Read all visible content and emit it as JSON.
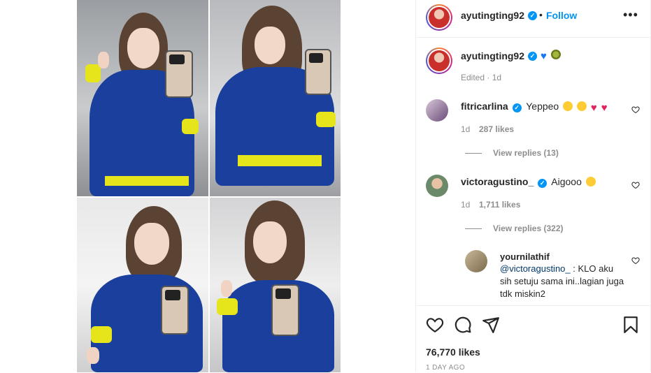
{
  "post": {
    "author": "ayutingting92",
    "follow_label": "Follow",
    "separator": "•",
    "more_label": "•••",
    "caption_meta": "Edited · 1d",
    "likes_label": "76,770 likes",
    "time_label": "1 DAY AGO"
  },
  "comments": [
    {
      "user": "fitricarlina",
      "text": "Yeppeo",
      "time": "1d",
      "likes": "287 likes",
      "view_replies": "View replies (13)"
    },
    {
      "user": "victoragustino_",
      "text": "Aigooo",
      "time": "1d",
      "likes": "1,711 likes",
      "view_replies": "View replies (322)"
    }
  ],
  "reply": {
    "user": "yournilathif",
    "mention": "@victoragustino_",
    "text": " : KLO aku sih setuju sama ini..lagian juga tdk miskin2"
  },
  "icons": {
    "verified": "verified-badge-icon",
    "like": "heart-icon",
    "comment": "comment-icon",
    "share": "share-icon",
    "save": "bookmark-icon"
  },
  "colors": {
    "accent": "#0095f6",
    "sweater": "#1a3f9c",
    "cuff": "#e6e51b"
  }
}
